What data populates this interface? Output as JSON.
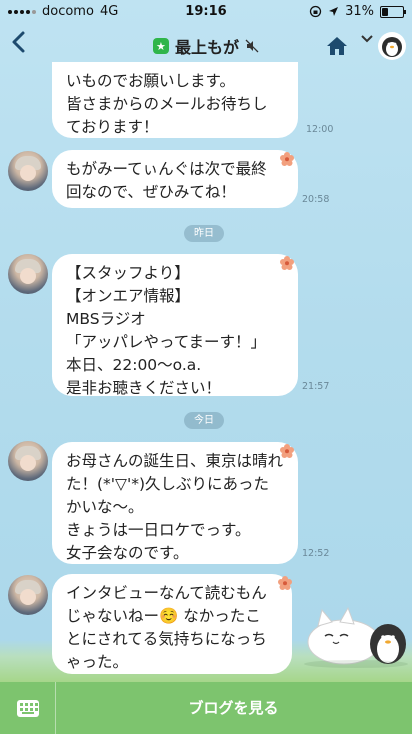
{
  "status_bar": {
    "carrier": "docomo",
    "network": "4G",
    "time": "19:16",
    "battery": "31%",
    "battery_level": 0.31
  },
  "nav": {
    "title": "最上もが",
    "back_icon": "chevron-left-icon",
    "verified_icon": "star-shield-icon",
    "mute_icon": "speaker-muted-icon",
    "home_icon": "home-icon",
    "menu_icon": "chevron-down-icon"
  },
  "messages": [
    {
      "text": "いものでお願いします。\n皆さまからのメールお待ちし\nております！",
      "time": "12:00"
    },
    {
      "text": "もがみーてぃんぐは次で最終\n回なので、ぜひみてね！",
      "time": "20:58"
    },
    {
      "text": "【スタッフより】\n【オンエア情報】\nMBSラジオ\n「アッパレやってまーす！」\n本日、22:00〜o.a.\n是非お聴きください！",
      "time": "21:57"
    },
    {
      "text": "お母さんの誕生日、東京は晴れ\nた！(*'▽'*)久しぶりにあった\nかいな〜。\nきょうは一日ロケでっす。\n女子会なのです。",
      "time": "12:52"
    },
    {
      "text": "インタビューなんて読むもん\nじゃないねー☺️ なかったこ\nとにされてる気持ちになっち\nゃった。",
      "time": ""
    }
  ],
  "date_separators": [
    "昨日",
    "今日"
  ],
  "bottom_bar": {
    "keyboard_icon": "keyboard-icon",
    "blog_button": "ブログを見る"
  },
  "colors": {
    "accent_green": "#7dc46e",
    "verified_green": "#2fb54a",
    "nav_blue": "#1d4a6e"
  }
}
